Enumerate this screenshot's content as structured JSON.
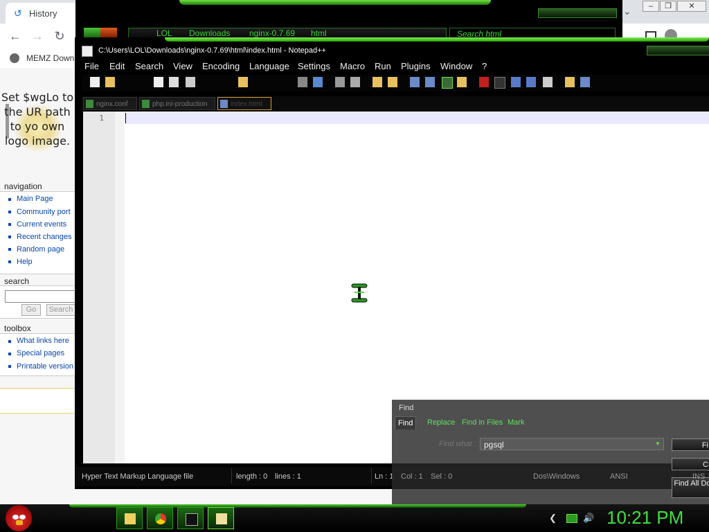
{
  "browser": {
    "tab_title": "History",
    "bookmark_label": "MEMZ Down",
    "logo_text": "Set $wgLo to the UR path to yo own logo image.",
    "nav_heading": "navigation",
    "nav_links": [
      "Main Page",
      "Community port",
      "Current events",
      "Recent changes",
      "Random page",
      "Help"
    ],
    "search_heading": "search",
    "go_label": "Go",
    "search_label": "Search",
    "toolbox_heading": "toolbox",
    "toolbox_links": [
      "What links here",
      "Special pages",
      "Printable version"
    ]
  },
  "explorer": {
    "breadcrumbs": [
      "LOL",
      "Downloads",
      "nginx-0.7.69",
      "html"
    ],
    "search_placeholder": "Search html"
  },
  "notepad": {
    "title": "C:\\Users\\LOL\\Downloads\\nginx-0.7.69\\html\\index.html - Notepad++",
    "menu": [
      "File",
      "Edit",
      "Search",
      "View",
      "Encoding",
      "Language",
      "Settings",
      "Macro",
      "Run",
      "Plugins",
      "Window",
      "?"
    ],
    "tabs": [
      "nginx.conf",
      "php.ini-production",
      "index.html"
    ],
    "line_number": "1",
    "status": {
      "filetype": "Hyper Text Markup Language file",
      "length": "length : 0",
      "lines": "lines : 1",
      "ln": "Ln : 1",
      "col": "Col : 1",
      "sel": "Sel : 0",
      "eol": "Dos\\Windows",
      "encoding": "ANSI",
      "mode": "INS"
    }
  },
  "find_dialog": {
    "title": "Find",
    "tabs": [
      "Find",
      "Replace",
      "Find in Files",
      "Mark"
    ],
    "find_what_label": "Find what :",
    "find_what_value": "pgsql",
    "buttons": [
      "Fi",
      "C",
      "Find All Do"
    ]
  },
  "taskbar": {
    "clock": "10:21 PM"
  },
  "colors": {
    "accent_green": "#3ee03e",
    "window_black": "#000000"
  }
}
